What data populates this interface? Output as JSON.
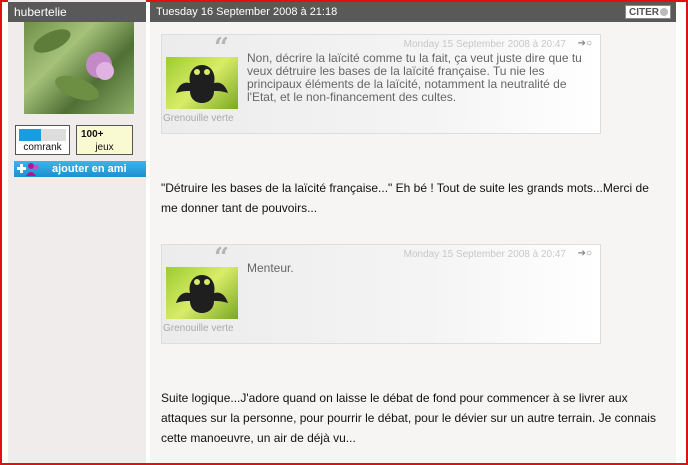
{
  "user": {
    "username": "hubertelie",
    "comrank_label": "comrank",
    "games_count": "100+",
    "games_label": "jeux",
    "add_friend_label": "ajouter en ami"
  },
  "post": {
    "date": "Tuesday 16 September 2008 à 21:18",
    "quote_button": "CITER",
    "quotes": [
      {
        "date": "Monday 15 September 2008 à 20:47",
        "author": "Grenouille verte",
        "text": "Non, décrire la laïcité comme tu la fait, ça veut juste dire que tu veux détruire les bases de la laïcité française. Tu nie les principaux éléments de la laïcité, notamment la neutralité de l'Etat, et le non-financement des cultes."
      },
      {
        "date": "Monday 15 September 2008 à 20:47",
        "author": "Grenouille verte",
        "text": "Menteur."
      }
    ],
    "replies": [
      "\"Détruire les bases de la laïcité française...\" Eh bé ! Tout de suite les grands mots...Merci de me donner tant de pouvoirs...",
      "Suite logique...J'adore quand on laisse le débat de fond pour commencer à se livrer aux attaques sur la personne, pour pourrir le débat, pour le dévier sur un autre terrain. Je connais cette manoeuvre, un air de déjà vu..."
    ]
  },
  "icons": {
    "quote_mark": "quote-mark-icon",
    "reply": "reply-icon",
    "add_friend": "add-friend-icon"
  },
  "colors": {
    "frame_border": "#dd1111",
    "header_bg": "#595959",
    "sidebar_bg": "#f1ecec",
    "content_bg": "#f7f5f3",
    "button_blue": "#1e8fcf"
  }
}
